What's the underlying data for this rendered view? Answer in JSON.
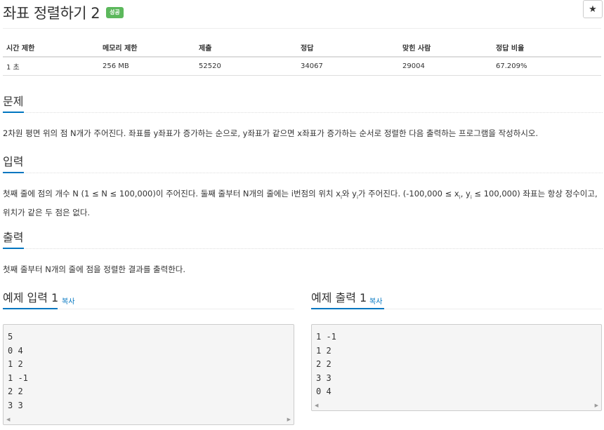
{
  "title": "좌표 정렬하기 2",
  "badge": "성공",
  "star_icon": "★",
  "info": {
    "headers": [
      "시간 제한",
      "메모리 제한",
      "제출",
      "정답",
      "맞힌 사람",
      "정답 비율"
    ],
    "values": [
      "1 초",
      "256 MB",
      "52520",
      "34067",
      "29004",
      "67.209%"
    ]
  },
  "sections": {
    "problem": {
      "title": "문제",
      "text": "2차원 평면 위의 점 N개가 주어진다. 좌표를 y좌표가 증가하는 순으로, y좌표가 같으면 x좌표가 증가하는 순서로 정렬한 다음 출력하는 프로그램을 작성하시오."
    },
    "input": {
      "title": "입력",
      "text_a": "첫째 줄에 점의 개수 N (1 ≤ N ≤ 100,000)이 주어진다. 둘째 줄부터 N개의 줄에는 i번점의 위치 x",
      "sub_i1": "i",
      "text_b": "와 y",
      "sub_i2": "i",
      "text_c": "가 주어진다. (-100,000 ≤ x",
      "sub_i3": "i",
      "text_d": ", y",
      "sub_i4": "i",
      "text_e": " ≤ 100,000) 좌표는 항상 정수이고, 위치가 같은 두 점은 없다."
    },
    "output": {
      "title": "출력",
      "text": "첫째 줄부터 N개의 줄에 점을 정렬한 결과를 출력한다."
    }
  },
  "examples": {
    "input": {
      "title": "예제 입력 1",
      "copy": "복사",
      "content": "5\n0 4\n1 2\n1 -1\n2 2\n3 3"
    },
    "output": {
      "title": "예제 출력 1",
      "copy": "복사",
      "content": "1 -1\n1 2\n2 2\n3 3\n0 4"
    }
  },
  "scroll": {
    "left": "◀",
    "right": "▶"
  },
  "colors": {
    "accent": "#0076c0",
    "badge": "#5cb85c"
  }
}
